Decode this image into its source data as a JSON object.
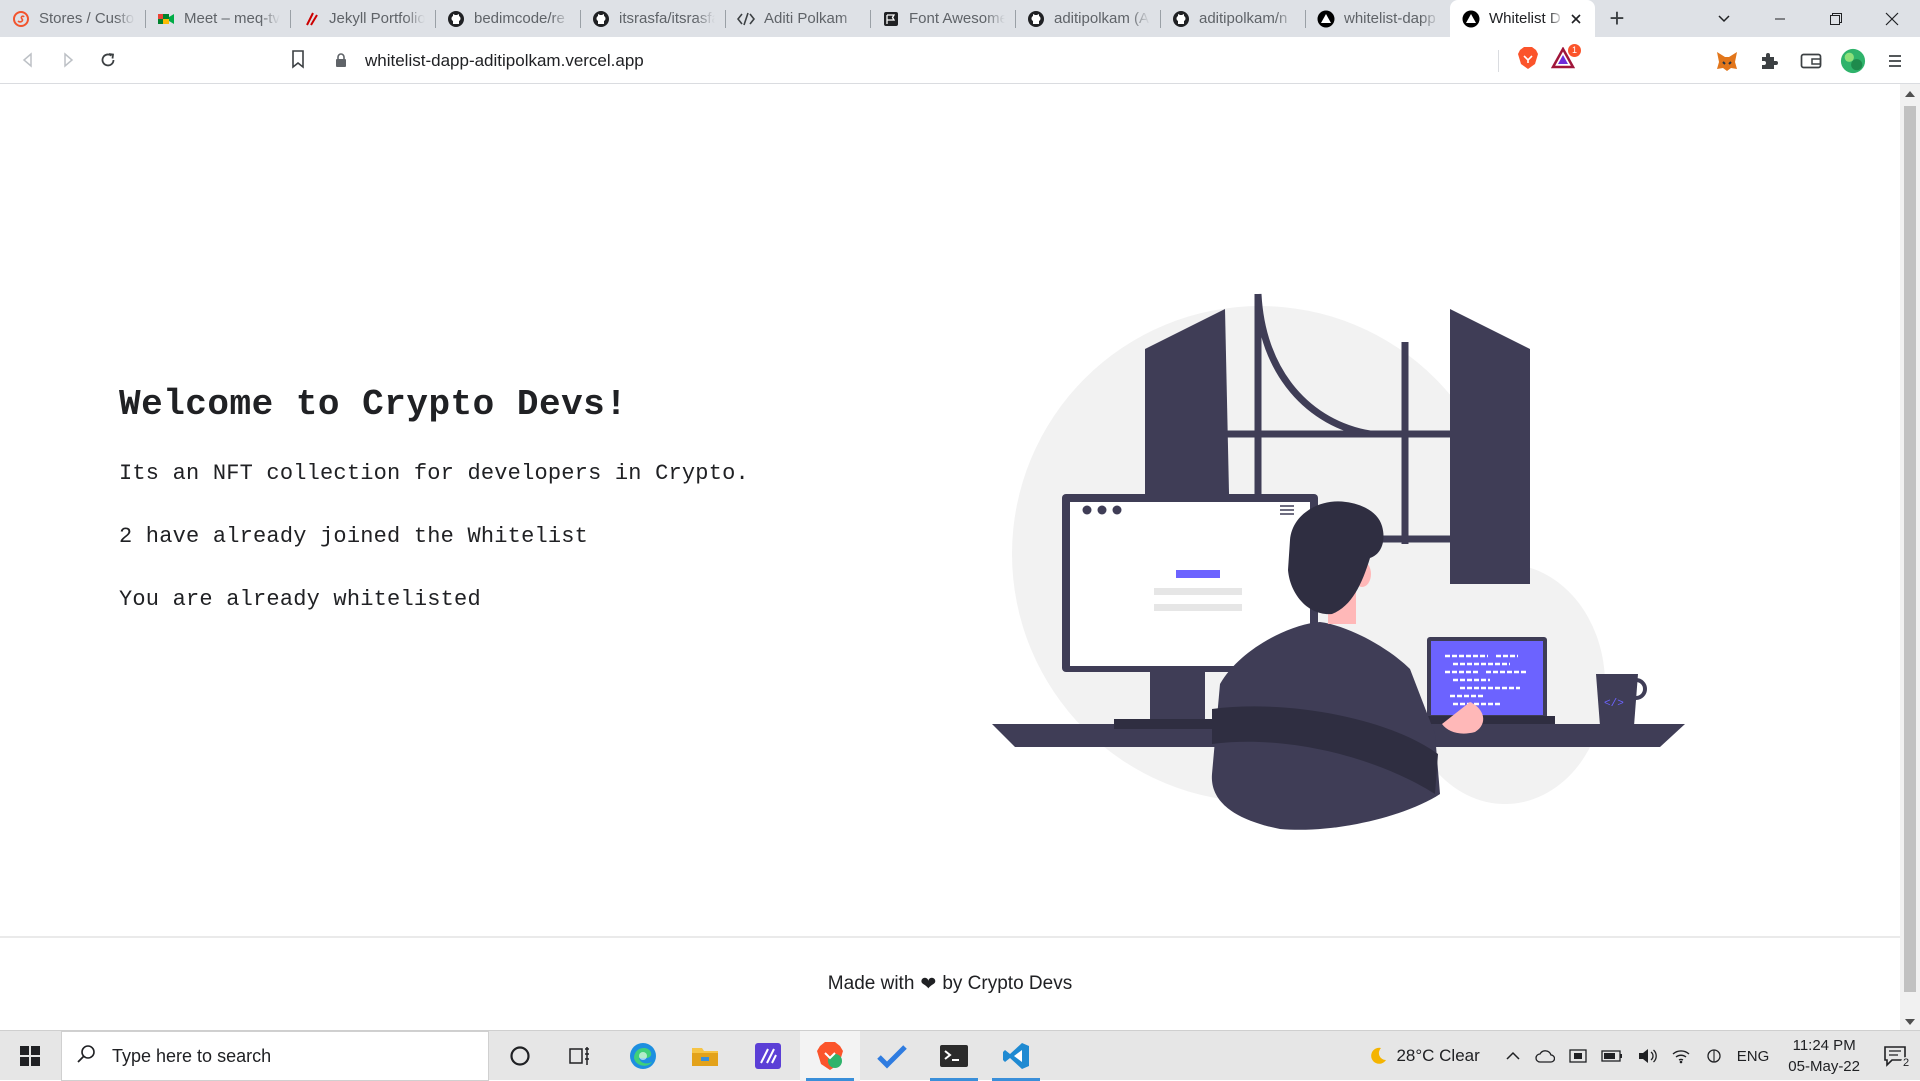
{
  "browser": {
    "tabs": [
      {
        "label": "Stores / Custon",
        "icon": "shopify-icon",
        "active": false
      },
      {
        "label": "Meet – meq-tv",
        "icon": "meet-icon",
        "active": false
      },
      {
        "label": "Jekyll Portfolio",
        "icon": "jekyll-icon",
        "active": false
      },
      {
        "label": "bedimcode/re",
        "icon": "github-icon",
        "active": false
      },
      {
        "label": "itsrasfa/itsrasfa",
        "icon": "github-icon",
        "active": false
      },
      {
        "label": "Aditi Polkam",
        "icon": "code-icon",
        "active": false
      },
      {
        "label": "Font Awesome",
        "icon": "flag-icon",
        "active": false
      },
      {
        "label": "aditipolkam (A",
        "icon": "github-icon",
        "active": false
      },
      {
        "label": "aditipolkam/n",
        "icon": "github-icon",
        "active": false
      },
      {
        "label": "whitelist-dapp",
        "icon": "vercel-icon",
        "active": false
      },
      {
        "label": "Whitelist D",
        "icon": "vercel-icon",
        "active": true
      }
    ],
    "url": "whitelist-dapp-aditipolkam.vercel.app",
    "brave_badge": "1"
  },
  "page": {
    "title": "Welcome to Crypto Devs!",
    "description": "Its an NFT collection for developers in Crypto.",
    "joined_text": "2 have already joined the Whitelist",
    "status_text": "You are already whitelisted",
    "footer_prefix": "Made with",
    "footer_heart": "❤",
    "footer_suffix": "by Crypto Devs"
  },
  "taskbar": {
    "search_placeholder": "Type here to search",
    "weather": "28°C  Clear",
    "language": "ENG",
    "time": "11:24 PM",
    "date": "05-May-22",
    "notification_count": "2"
  },
  "colors": {
    "accent_purple": "#6c63ff",
    "dark_figure": "#3f3d56",
    "skin": "#ffb8b8",
    "taskbar_bg": "#e6e6e6",
    "tabstrip_bg": "#dee1e6"
  }
}
